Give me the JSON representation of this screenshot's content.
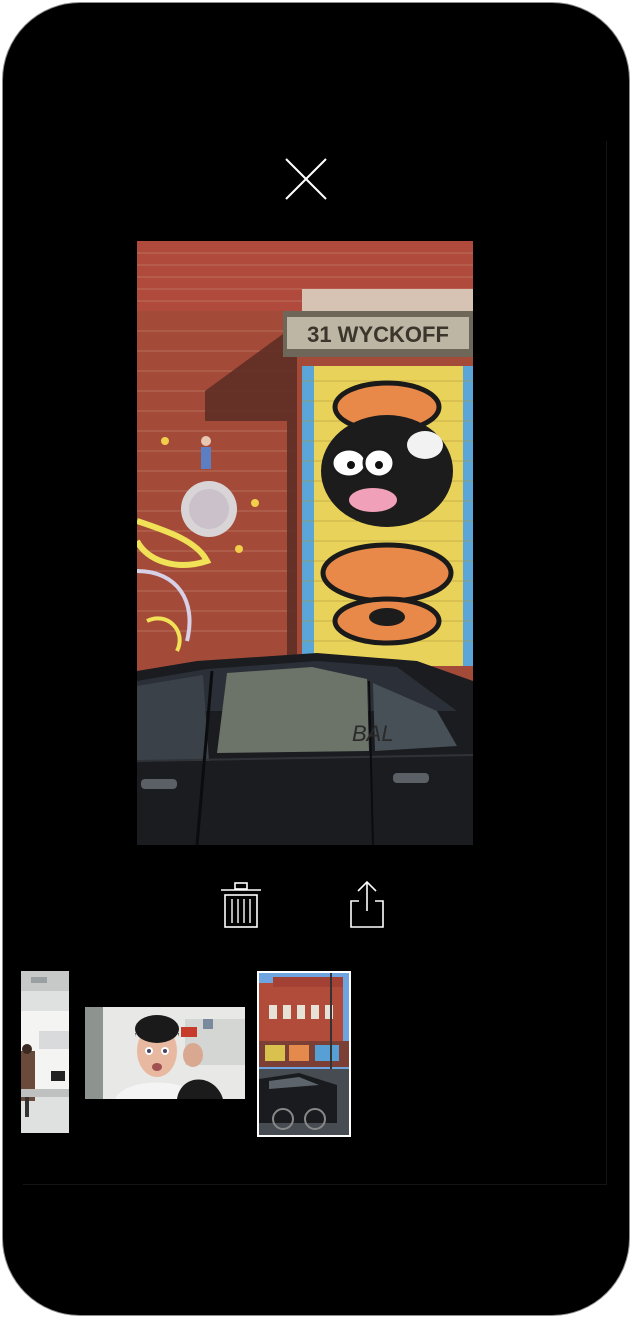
{
  "viewer": {
    "photo_sign_text": "31 WYCKOFF",
    "mural_tag_text": "BAL",
    "photo_icon": "graffiti-photo"
  },
  "toolbar": {
    "close_icon": "close-icon",
    "delete_icon": "trash-icon",
    "share_icon": "share-icon"
  },
  "thumbnails": [
    {
      "name": "office-photo",
      "selected": false
    },
    {
      "name": "selfie-photo",
      "selected": false
    },
    {
      "name": "street-building-photo",
      "selected": true
    }
  ],
  "colors": {
    "background": "#000000",
    "icon": "#ffffff",
    "device_border": "#8e8e8e"
  }
}
